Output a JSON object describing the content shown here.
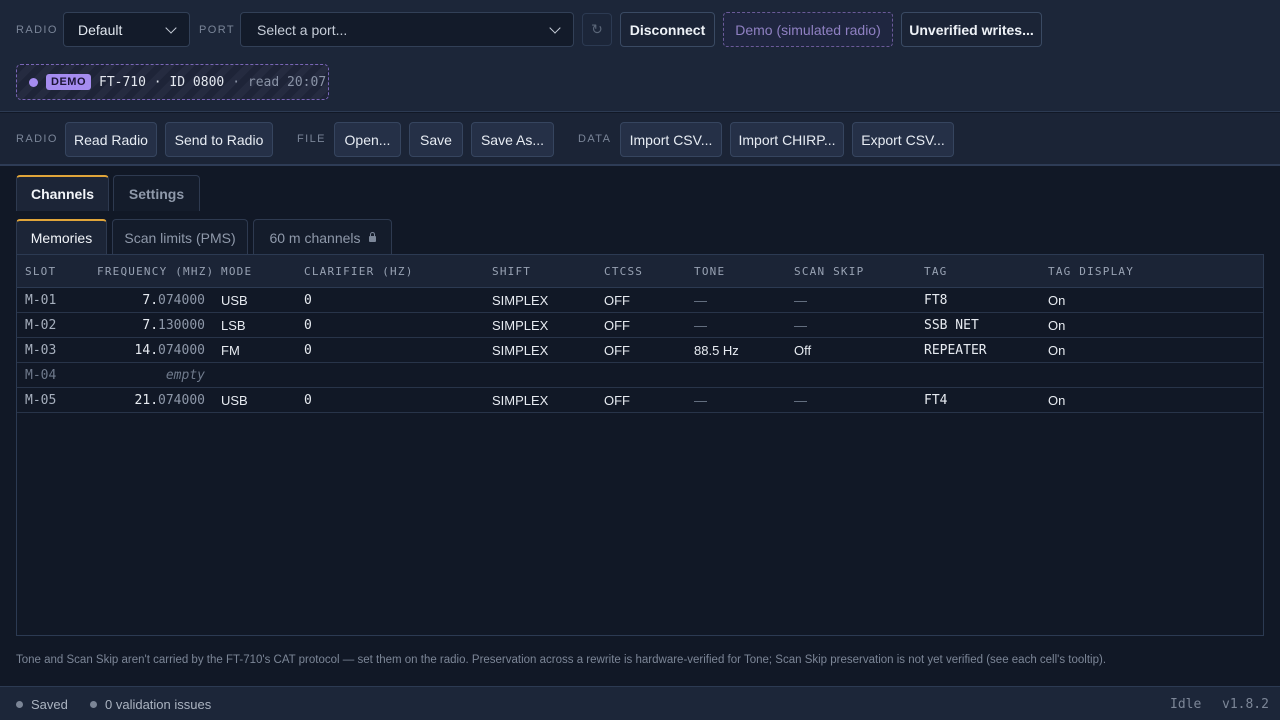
{
  "connection": {
    "radio_label": "RADIO",
    "radio_value": "Default",
    "port_label": "PORT",
    "port_placeholder": "Select a port...",
    "disconnect_label": "Disconnect",
    "demo_label": "Demo (simulated radio)",
    "unverified_label": "Unverified writes...",
    "refresh_icon": "↻"
  },
  "chip": {
    "badge": "DEMO",
    "model": "FT-710 · ID 0800",
    "read": "· read 20:07"
  },
  "toolbar": {
    "radio_label": "RADIO",
    "read_radio": "Read Radio",
    "send_to_radio": "Send to Radio",
    "file_label": "FILE",
    "open": "Open...",
    "save": "Save",
    "save_as": "Save As...",
    "data_label": "DATA",
    "import_csv": "Import CSV...",
    "import_chirp": "Import CHIRP...",
    "export_csv": "Export CSV..."
  },
  "tabs": {
    "channels": "Channels",
    "settings": "Settings"
  },
  "subtabs": {
    "memories": "Memories",
    "scan_limits": "Scan limits (PMS)",
    "sixty_m": "60 m channels"
  },
  "table": {
    "headers": [
      "SLOT",
      "FREQUENCY (MHZ)",
      "MODE",
      "CLARIFIER (HZ)",
      "SHIFT",
      "CTCSS",
      "TONE",
      "SCAN SKIP",
      "TAG",
      "TAG DISPLAY"
    ],
    "rows": [
      {
        "slot": "M-01",
        "freq_int": "7.",
        "freq_frac": "074000",
        "mode": "USB",
        "clarifier": "0",
        "shift": "SIMPLEX",
        "ctcss": "OFF",
        "tone": "—",
        "scan_skip": "—",
        "tag": "FT8",
        "tag_display": "On"
      },
      {
        "slot": "M-02",
        "freq_int": "7.",
        "freq_frac": "130000",
        "mode": "LSB",
        "clarifier": "0",
        "shift": "SIMPLEX",
        "ctcss": "OFF",
        "tone": "—",
        "scan_skip": "—",
        "tag": "SSB NET",
        "tag_display": "On"
      },
      {
        "slot": "M-03",
        "freq_int": "14.",
        "freq_frac": "074000",
        "mode": "FM",
        "clarifier": "0",
        "shift": "SIMPLEX",
        "ctcss": "OFF",
        "tone": "88.5 Hz",
        "scan_skip": "Off",
        "tag": "REPEATER",
        "tag_display": "On"
      },
      {
        "slot": "M-04",
        "empty": "empty"
      },
      {
        "slot": "M-05",
        "freq_int": "21.",
        "freq_frac": "074000",
        "mode": "USB",
        "clarifier": "0",
        "shift": "SIMPLEX",
        "ctcss": "OFF",
        "tone": "—",
        "scan_skip": "—",
        "tag": "FT4",
        "tag_display": "On"
      }
    ]
  },
  "note": "Tone and Scan Skip aren't carried by the FT-710's CAT protocol — set them on the radio. Preservation across a rewrite is hardware-verified for Tone; Scan Skip preservation is not yet verified (see each cell's tooltip).",
  "status": {
    "saved": "Saved",
    "validation": "0 validation issues",
    "state": "Idle",
    "version": "v1.8.2"
  }
}
